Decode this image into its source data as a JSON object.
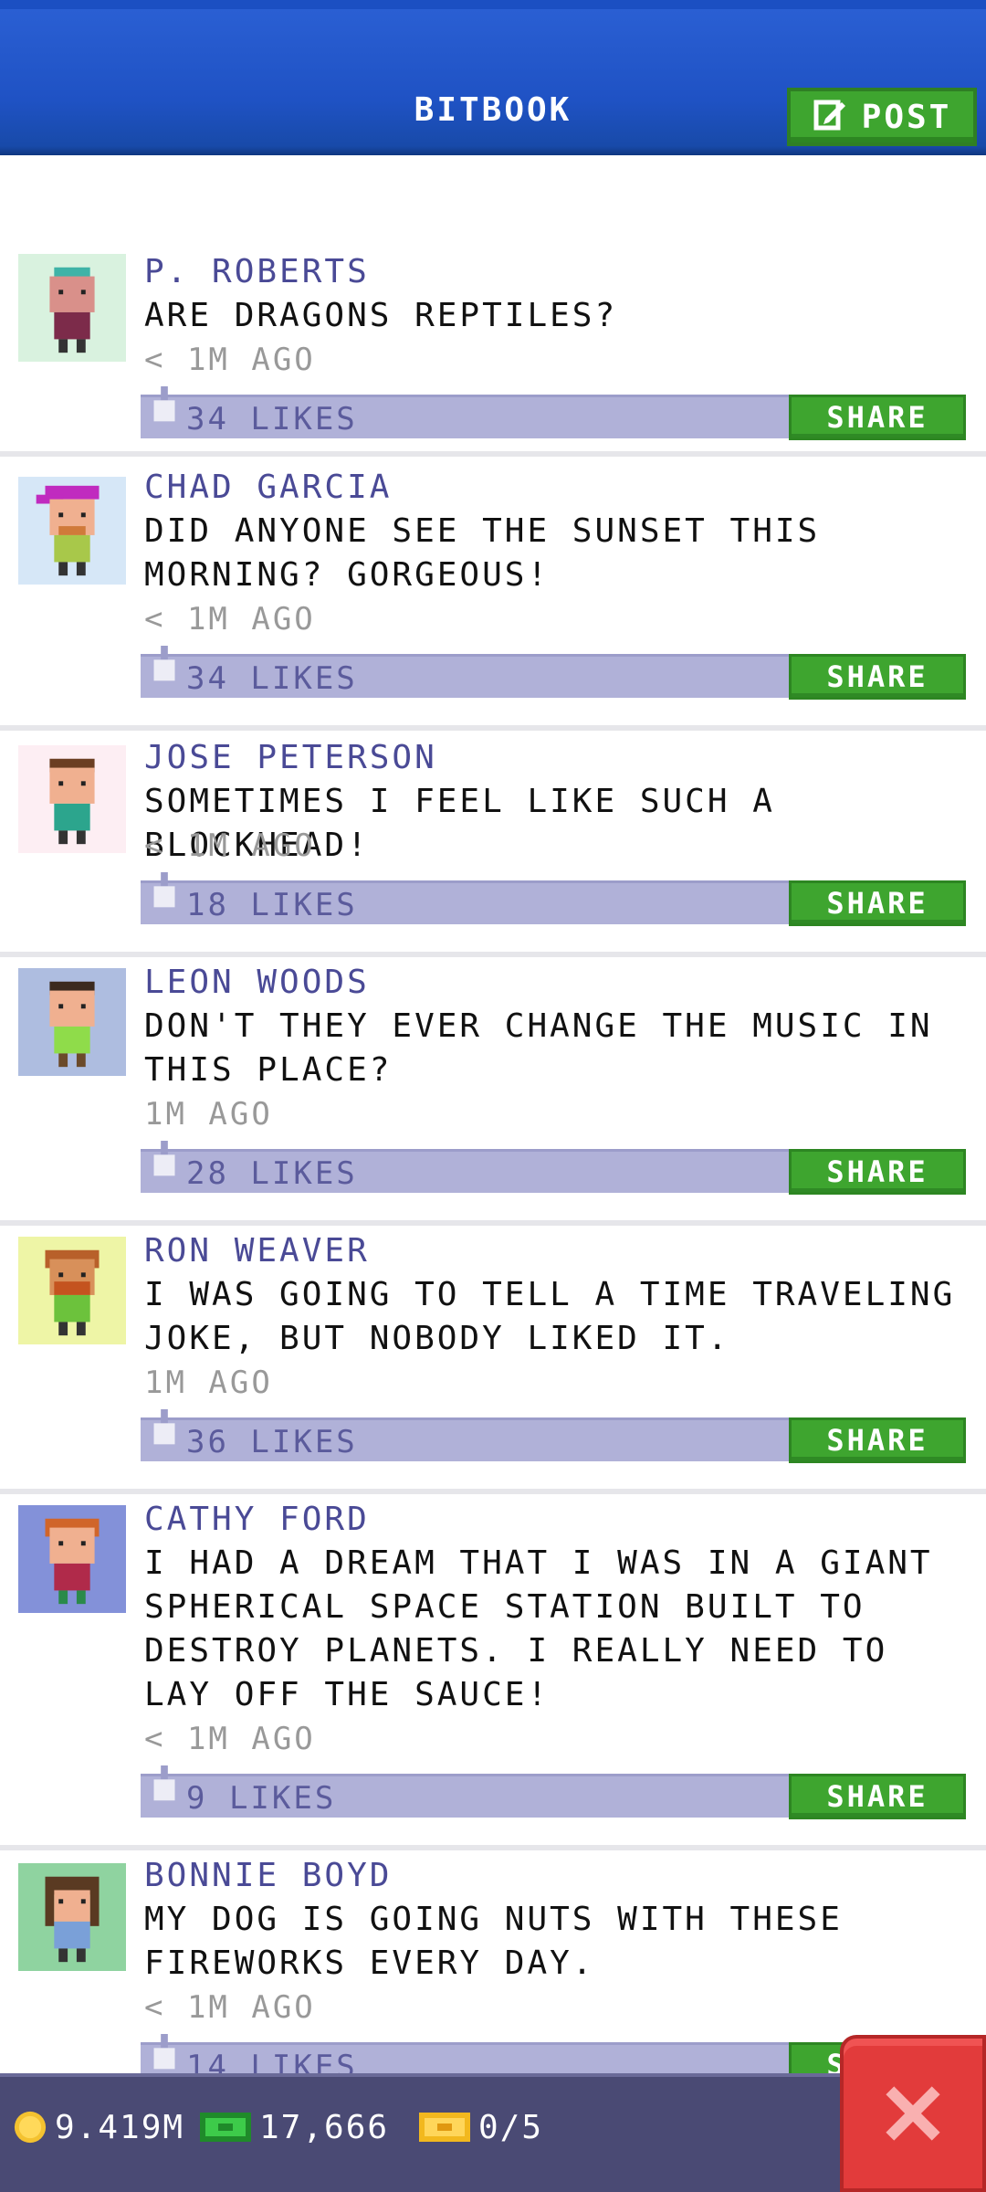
{
  "header": {
    "title": "BITBOOK",
    "post_label": "POST"
  },
  "posts": [
    {
      "name": "P. ROBERTS",
      "message": "ARE DRAGONS REPTILES?",
      "time": "< 1M AGO",
      "likes": "34 LIKES",
      "share": "SHARE",
      "avatar_bg": "#d9f2df"
    },
    {
      "name": "CHAD GARCIA",
      "message": "DID ANYONE SEE THE SUNSET THIS MORNING? GORGEOUS!",
      "time": "< 1M AGO",
      "likes": "34 LIKES",
      "share": "SHARE",
      "avatar_bg": "#d6e7f7"
    },
    {
      "name": "JOSE PETERSON",
      "message": "SOMETIMES I FEEL LIKE SUCH A BLOCKHEAD!",
      "time": "< 1M AGO",
      "likes": "18 LIKES",
      "share": "SHARE",
      "avatar_bg": "#fdeef3"
    },
    {
      "name": "LEON WOODS",
      "message": "DON'T THEY EVER CHANGE THE MUSIC IN THIS PLACE?",
      "time": "1M AGO",
      "likes": "28 LIKES",
      "share": "SHARE",
      "avatar_bg": "#aebde0"
    },
    {
      "name": "RON WEAVER",
      "message": "I WAS GOING TO TELL A TIME TRAVELING JOKE, BUT NOBODY LIKED IT.",
      "time": "1M AGO",
      "likes": "36 LIKES",
      "share": "SHARE",
      "avatar_bg": "#eef5a6"
    },
    {
      "name": "CATHY FORD",
      "message": "I HAD A DREAM THAT I WAS IN A GIANT SPHERICAL SPACE STATION BUILT TO DESTROY PLANETS. I REALLY NEED TO LAY OFF THE SAUCE!",
      "time": "< 1M AGO",
      "likes": "9 LIKES",
      "share": "SHARE",
      "avatar_bg": "#8391d9"
    },
    {
      "name": "BONNIE BOYD",
      "message": "MY DOG IS GOING NUTS WITH THESE FIREWORKS EVERY DAY.",
      "time": "< 1M AGO",
      "likes": "14 LIKES",
      "share": "SHARE",
      "avatar_bg": "#8fd3a0"
    }
  ],
  "status": {
    "coins": "9.419M",
    "bux": "17,666",
    "tickets": "0/5"
  },
  "colors": {
    "accent_green": "#3ea52f",
    "header_blue": "#1f52c4",
    "like_bar": "#b0b1d8",
    "close_red": "#e23b3b"
  }
}
